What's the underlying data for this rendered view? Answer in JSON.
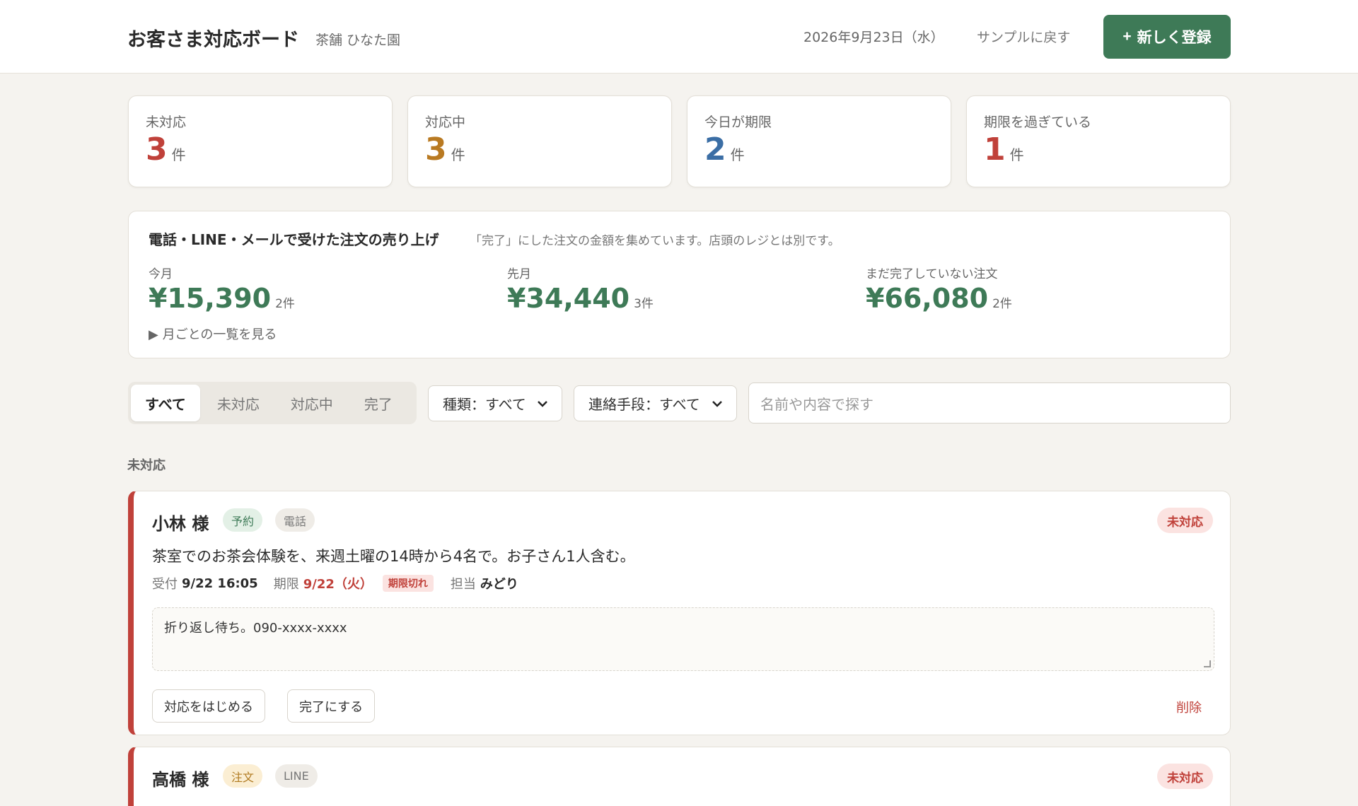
{
  "header": {
    "title": "お客さま対応ボード",
    "shop": "茶舗 ひなた園",
    "date": "2026年9月23日（水）",
    "back_label": "サンプルに戻す",
    "new_label": "新しく登録",
    "plus": "+"
  },
  "stats": [
    {
      "label": "未対応",
      "value": "3",
      "unit": "件",
      "color": "#c0413a"
    },
    {
      "label": "対応中",
      "value": "3",
      "unit": "件",
      "color": "#b97a22"
    },
    {
      "label": "今日が期限",
      "value": "2",
      "unit": "件",
      "color": "#3b6ea5"
    },
    {
      "label": "期限を過ぎている",
      "value": "1",
      "unit": "件",
      "color": "#c0413a"
    }
  ],
  "sales": {
    "title": "電話・LINE・メールで受けた注文の売り上げ",
    "note": "「完了」にした注文の金額を集めています。店頭のレジとは別です。",
    "columns": [
      {
        "label": "今月",
        "amount": "¥15,390",
        "count": "2件"
      },
      {
        "label": "先月",
        "amount": "¥34,440",
        "count": "3件"
      },
      {
        "label": "まだ完了していない注文",
        "amount": "¥66,080",
        "count": "2件"
      }
    ],
    "monthly_toggle": "▶ 月ごとの一覧を見る"
  },
  "filters": {
    "tabs": [
      "すべて",
      "未対応",
      "対応中",
      "完了"
    ],
    "type_select": "種類：すべて",
    "channel_select": "連絡手段：すべて",
    "search_placeholder": "名前や内容で探す"
  },
  "section": {
    "heading": "未対応"
  },
  "items": [
    {
      "name": "小林 様",
      "kind": "予約",
      "channel": "電話",
      "status": "未対応",
      "description": "茶室でのお茶会体験を、来週土曜の14時から4名で。お子さん1人含む。",
      "received_label": "受付",
      "received": "9/22 16:05",
      "due_label": "期限",
      "due": "9/22（火）",
      "overdue": "期限切れ",
      "assignee_label": "担当",
      "assignee": "みどり",
      "note": "折り返し待ち。090-xxxx-xxxx",
      "start_label": "対応をはじめる",
      "complete_label": "完了にする",
      "delete_label": "削除"
    },
    {
      "name": "高橋 様",
      "kind": "注文",
      "channel": "LINE",
      "status": "未対応"
    }
  ]
}
